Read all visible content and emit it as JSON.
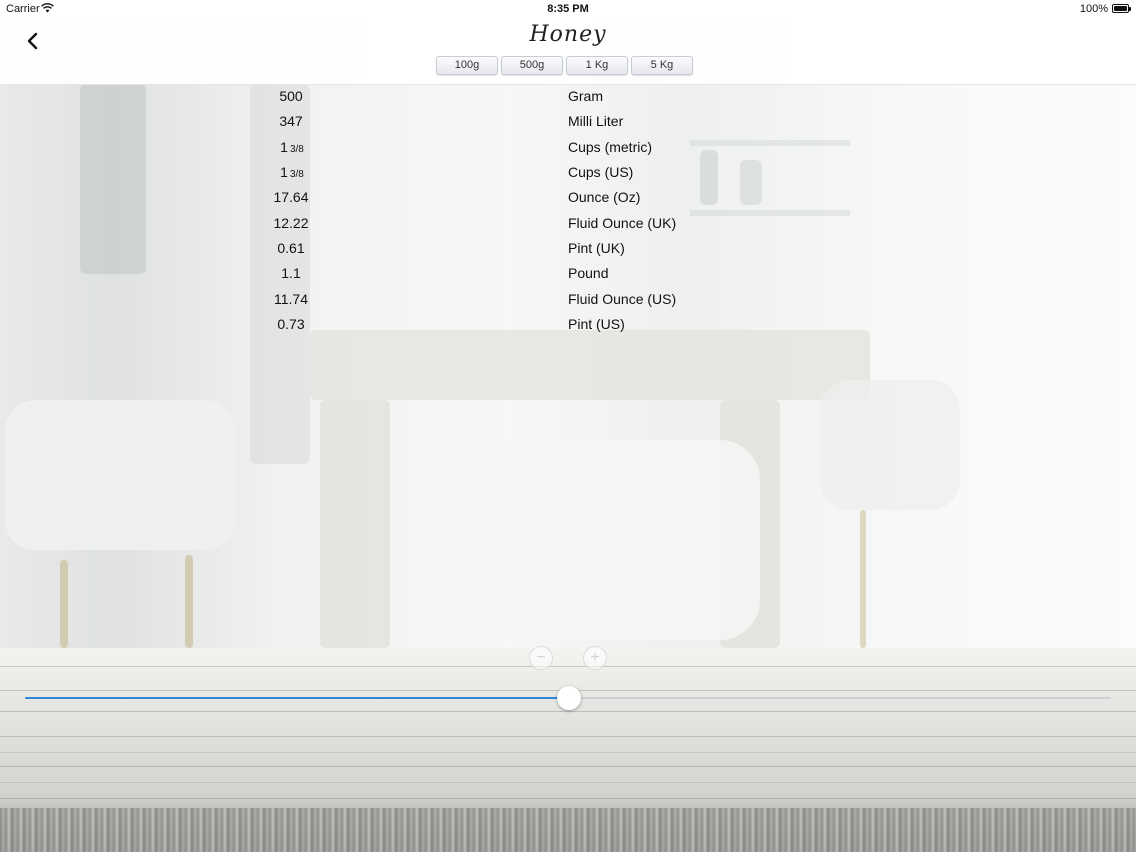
{
  "status_bar": {
    "carrier": "Carrier",
    "time": "8:35 PM",
    "battery": "100%"
  },
  "nav": {
    "title": "Honey",
    "segments": [
      {
        "label": "100g"
      },
      {
        "label": "500g"
      },
      {
        "label": "1 Kg"
      },
      {
        "label": "5 Kg"
      }
    ]
  },
  "conversions": [
    {
      "value": "500",
      "fraction": "",
      "unit": "Gram"
    },
    {
      "value": "347",
      "fraction": "",
      "unit": "Milli Liter"
    },
    {
      "value": "1",
      "fraction": "3/8",
      "unit": "Cups (metric)"
    },
    {
      "value": "1",
      "fraction": "3/8",
      "unit": "Cups (US)"
    },
    {
      "value": "17.64",
      "fraction": "",
      "unit": "Ounce (Oz)"
    },
    {
      "value": "12.22",
      "fraction": "",
      "unit": "Fluid Ounce (UK)"
    },
    {
      "value": "0.61",
      "fraction": "",
      "unit": "Pint (UK)"
    },
    {
      "value": "1.1",
      "fraction": "",
      "unit": "Pound"
    },
    {
      "value": "11.74",
      "fraction": "",
      "unit": "Fluid Ounce (US)"
    },
    {
      "value": "0.73",
      "fraction": "",
      "unit": "Pint (US)"
    }
  ],
  "stepper": {
    "minus": "−",
    "plus": "+"
  },
  "slider": {
    "fraction": 0.501
  },
  "colors": {
    "accent": "#2f86d8"
  }
}
